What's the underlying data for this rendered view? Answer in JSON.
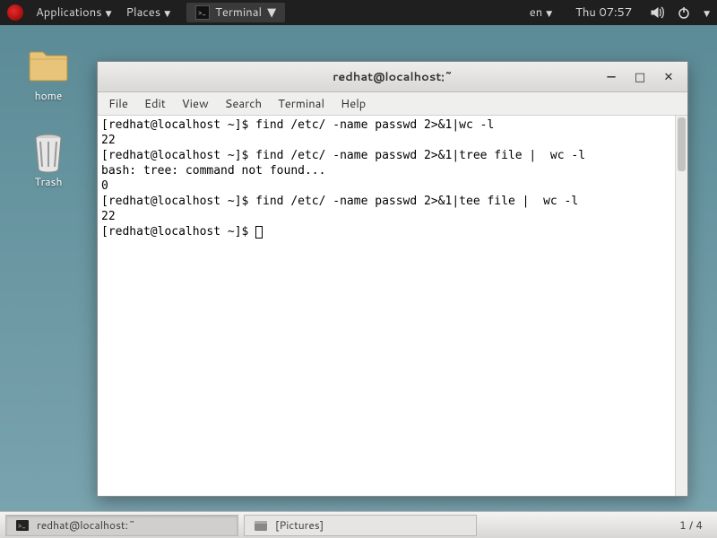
{
  "top_panel": {
    "applications": "Applications",
    "places": "Places",
    "active_app": "Terminal",
    "lang": "en",
    "clock": "Thu 07:57"
  },
  "desktop": {
    "home_label": "home",
    "trash_label": "Trash"
  },
  "window": {
    "title": "redhat@localhost:~",
    "menu": {
      "file": "File",
      "edit": "Edit",
      "view": "View",
      "search": "Search",
      "terminal": "Terminal",
      "help": "Help"
    },
    "lines": [
      "[redhat@localhost ~]$ find /etc/ -name passwd 2>&1|wc -l",
      "22",
      "[redhat@localhost ~]$ find /etc/ -name passwd 2>&1|tree file |  wc -l",
      "bash: tree: command not found...",
      "0",
      "[redhat@localhost ~]$ find /etc/ -name passwd 2>&1|tee file |  wc -l",
      "22",
      "[redhat@localhost ~]$ "
    ]
  },
  "bottom_panel": {
    "task1": "redhat@localhost:~",
    "task2": "[Pictures]",
    "workspace": "1 / 4"
  }
}
